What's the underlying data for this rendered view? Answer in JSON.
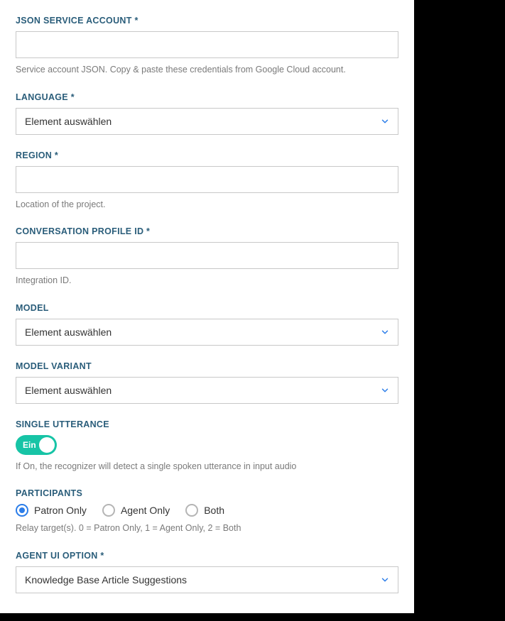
{
  "fields": {
    "json_service_account": {
      "label": "JSON SERVICE ACCOUNT *",
      "value": "",
      "help": "Service account JSON. Copy & paste these credentials from Google Cloud account."
    },
    "language": {
      "label": "LANGUAGE *",
      "selected": "Element auswählen"
    },
    "region": {
      "label": "REGION *",
      "value": "",
      "help": "Location of the project."
    },
    "conversation_profile_id": {
      "label": "CONVERSATION PROFILE ID *",
      "value": "",
      "help": "Integration ID."
    },
    "model": {
      "label": "MODEL",
      "selected": "Element auswählen"
    },
    "model_variant": {
      "label": "MODEL VARIANT",
      "selected": "Element auswählen"
    },
    "single_utterance": {
      "label": "SINGLE UTTERANCE",
      "state_text": "Ein",
      "help": "If On, the recognizer will detect a single spoken utterance in input audio"
    },
    "participants": {
      "label": "PARTICIPANTS",
      "options": {
        "patron": "Patron Only",
        "agent": "Agent Only",
        "both": "Both"
      },
      "help": "Relay target(s). 0 = Patron Only, 1 = Agent Only, 2 = Both"
    },
    "agent_ui_option": {
      "label": "AGENT UI OPTION *",
      "selected": "Knowledge Base Article Suggestions"
    }
  },
  "colors": {
    "accent": "#2b7de9",
    "toggle_on": "#17c4a6",
    "label": "#2a5d7a"
  }
}
